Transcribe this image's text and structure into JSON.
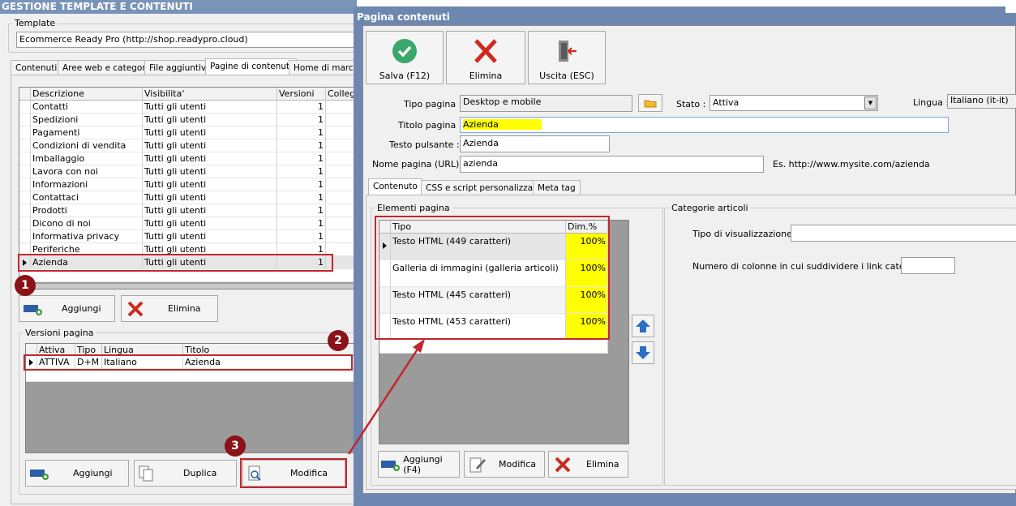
{
  "main": {
    "title": "GESTIONE TEMPLATE E CONTENUTI",
    "template_label": "Template",
    "template_value": "Ecommerce Ready Pro (http://shop.readypro.cloud)",
    "tabs": [
      "Contenuti",
      "Aree web e categorie",
      "File aggiuntivi",
      "Pagine di contenuti",
      "Home di marca"
    ],
    "pages_columns": [
      "Descrizione",
      "Visibilita'",
      "Versioni",
      "Collega"
    ],
    "pages_rows": [
      {
        "descrizione": "Contatti",
        "visibilita": "Tutti gli utenti",
        "versioni": "1"
      },
      {
        "descrizione": "Spedizioni",
        "visibilita": "Tutti gli utenti",
        "versioni": "1"
      },
      {
        "descrizione": "Pagamenti",
        "visibilita": "Tutti gli utenti",
        "versioni": "1"
      },
      {
        "descrizione": "Condizioni di vendita",
        "visibilita": "Tutti gli utenti",
        "versioni": "1"
      },
      {
        "descrizione": "Imballaggio",
        "visibilita": "Tutti gli utenti",
        "versioni": "1"
      },
      {
        "descrizione": "Lavora con noi",
        "visibilita": "Tutti gli utenti",
        "versioni": "1"
      },
      {
        "descrizione": "Informazioni",
        "visibilita": "Tutti gli utenti",
        "versioni": "1"
      },
      {
        "descrizione": "Contattaci",
        "visibilita": "Tutti gli utenti",
        "versioni": "1"
      },
      {
        "descrizione": "Prodotti",
        "visibilita": "Tutti gli utenti",
        "versioni": "1"
      },
      {
        "descrizione": "Dicono di noi",
        "visibilita": "Tutti gli utenti",
        "versioni": "1"
      },
      {
        "descrizione": "Informativa privacy",
        "visibilita": "Tutti gli utenti",
        "versioni": "1"
      },
      {
        "descrizione": "Periferiche",
        "visibilita": "Tutti gli utenti",
        "versioni": "1"
      },
      {
        "descrizione": "Azienda",
        "visibilita": "Tutti gli utenti",
        "versioni": "1"
      }
    ],
    "add_label": "Aggiungi",
    "delete_label": "Elimina",
    "versions_label": "Versioni pagina",
    "versions_columns": [
      "Attiva",
      "Tipo",
      "Lingua",
      "Titolo"
    ],
    "versions_rows": [
      {
        "attiva": "ATTIVA",
        "tipo": "D+M",
        "lingua": "Italiano",
        "titolo": "Azienda"
      }
    ],
    "v_add_label": "Aggiungi",
    "v_duplicate_label": "Duplica",
    "v_modify_label": "Modifica"
  },
  "dialog": {
    "title": "Pagina contenuti",
    "save_label": "Salva (F12)",
    "delete_label": "Elimina",
    "exit_label": "Uscita (ESC)",
    "tipo_pagina_label": "Tipo pagina :",
    "tipo_pagina_value": "Desktop e mobile",
    "stato_label": "Stato :",
    "stato_value": "Attiva",
    "lingua_label": "Lingua :",
    "lingua_value": "Italiano (it-it)",
    "titolo_label": "Titolo pagina :",
    "titolo_value": "Azienda",
    "testo_label": "Testo pulsante :",
    "testo_value": "Azienda",
    "nome_label": "Nome pagina (URL) :",
    "nome_value": "azienda",
    "example_text": "Es. http://www.mysite.com/azienda",
    "tabs": [
      "Contenuto",
      "CSS e script personalizzati",
      "Meta tag"
    ],
    "elements_label": "Elementi pagina",
    "elements_columns": [
      "Tipo",
      "Dim.%"
    ],
    "elements_rows": [
      {
        "tipo": "Testo HTML (449 caratteri)",
        "dim": "100%"
      },
      {
        "tipo": "Galleria di immagini (galleria articoli)",
        "dim": "100%"
      },
      {
        "tipo": "Testo HTML (445 caratteri)",
        "dim": "100%"
      },
      {
        "tipo": "Testo HTML (453 caratteri)",
        "dim": "100%"
      }
    ],
    "el_add_label": "Aggiungi (F4)",
    "el_modify_label": "Modifica",
    "el_delete_label": "Elimina",
    "categories_label": "Categorie articoli",
    "visualization_label": "Tipo di visualizzazione :",
    "columns_label": "Numero di colonne in cui suddividere i link categorie :"
  },
  "annotations": [
    "1",
    "2",
    "3"
  ],
  "colors": {
    "titlebar": "#6d87b0",
    "annotation_red": "#c1272d",
    "highlight_yellow": "#ffff00"
  }
}
